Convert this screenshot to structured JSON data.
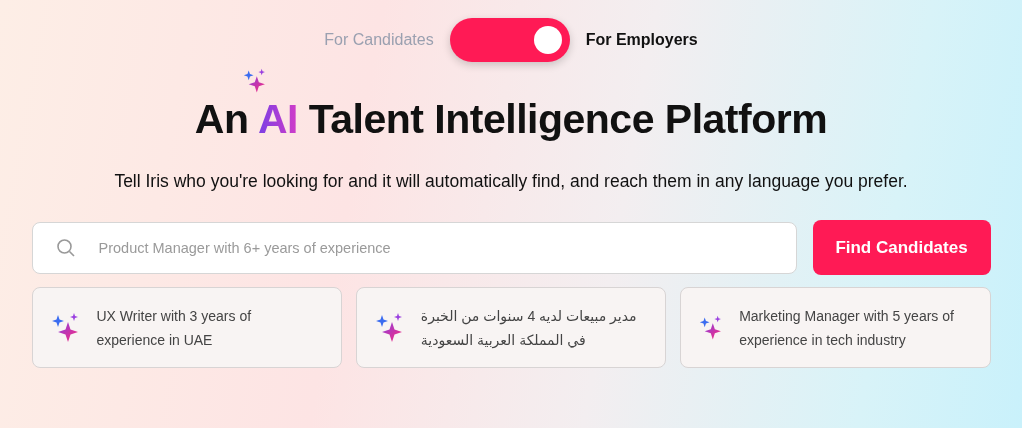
{
  "audience_toggle": {
    "options": [
      {
        "label": "For Candidates",
        "selected": false
      },
      {
        "label": "For Employers",
        "selected": true
      }
    ]
  },
  "title": [
    {
      "text": "An ",
      "highlight": false
    },
    {
      "text": "AI",
      "highlight": true
    },
    {
      "text": " Talent Intelligence Platform",
      "highlight": false
    }
  ],
  "subtitle": "Tell Iris who you're looking for and it will automatically find, and reach them in any language you prefer.",
  "search": {
    "placeholder": "Product Manager with 6+ years of experience",
    "button": "Find Candidates"
  },
  "suggestions": [
    {
      "text": "UX Writer with 3 years of experience in UAE"
    },
    {
      "text": "مدير مبيعات لديه 4 سنوات من الخبرة في المملكة العربية السعودية"
    },
    {
      "text": "Marketing Manager with 5 years of experience in tech industry"
    }
  ]
}
